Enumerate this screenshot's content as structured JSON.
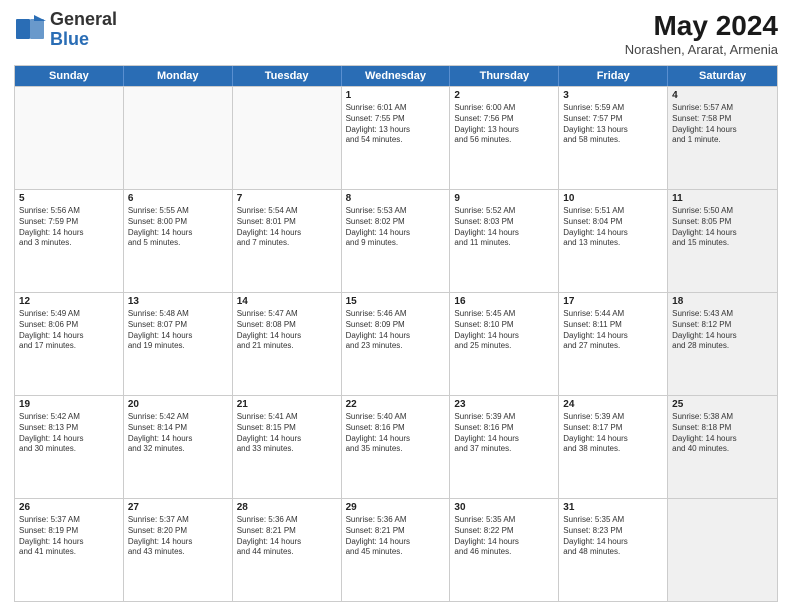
{
  "header": {
    "logo_general": "General",
    "logo_blue": "Blue",
    "month_title": "May 2024",
    "subtitle": "Norashen, Ararat, Armenia"
  },
  "days_of_week": [
    "Sunday",
    "Monday",
    "Tuesday",
    "Wednesday",
    "Thursday",
    "Friday",
    "Saturday"
  ],
  "rows": [
    [
      {
        "day": "",
        "lines": [],
        "shaded": false
      },
      {
        "day": "",
        "lines": [],
        "shaded": false
      },
      {
        "day": "",
        "lines": [],
        "shaded": false
      },
      {
        "day": "1",
        "lines": [
          "Sunrise: 6:01 AM",
          "Sunset: 7:55 PM",
          "Daylight: 13 hours",
          "and 54 minutes."
        ],
        "shaded": false
      },
      {
        "day": "2",
        "lines": [
          "Sunrise: 6:00 AM",
          "Sunset: 7:56 PM",
          "Daylight: 13 hours",
          "and 56 minutes."
        ],
        "shaded": false
      },
      {
        "day": "3",
        "lines": [
          "Sunrise: 5:59 AM",
          "Sunset: 7:57 PM",
          "Daylight: 13 hours",
          "and 58 minutes."
        ],
        "shaded": false
      },
      {
        "day": "4",
        "lines": [
          "Sunrise: 5:57 AM",
          "Sunset: 7:58 PM",
          "Daylight: 14 hours",
          "and 1 minute."
        ],
        "shaded": true
      }
    ],
    [
      {
        "day": "5",
        "lines": [
          "Sunrise: 5:56 AM",
          "Sunset: 7:59 PM",
          "Daylight: 14 hours",
          "and 3 minutes."
        ],
        "shaded": false
      },
      {
        "day": "6",
        "lines": [
          "Sunrise: 5:55 AM",
          "Sunset: 8:00 PM",
          "Daylight: 14 hours",
          "and 5 minutes."
        ],
        "shaded": false
      },
      {
        "day": "7",
        "lines": [
          "Sunrise: 5:54 AM",
          "Sunset: 8:01 PM",
          "Daylight: 14 hours",
          "and 7 minutes."
        ],
        "shaded": false
      },
      {
        "day": "8",
        "lines": [
          "Sunrise: 5:53 AM",
          "Sunset: 8:02 PM",
          "Daylight: 14 hours",
          "and 9 minutes."
        ],
        "shaded": false
      },
      {
        "day": "9",
        "lines": [
          "Sunrise: 5:52 AM",
          "Sunset: 8:03 PM",
          "Daylight: 14 hours",
          "and 11 minutes."
        ],
        "shaded": false
      },
      {
        "day": "10",
        "lines": [
          "Sunrise: 5:51 AM",
          "Sunset: 8:04 PM",
          "Daylight: 14 hours",
          "and 13 minutes."
        ],
        "shaded": false
      },
      {
        "day": "11",
        "lines": [
          "Sunrise: 5:50 AM",
          "Sunset: 8:05 PM",
          "Daylight: 14 hours",
          "and 15 minutes."
        ],
        "shaded": true
      }
    ],
    [
      {
        "day": "12",
        "lines": [
          "Sunrise: 5:49 AM",
          "Sunset: 8:06 PM",
          "Daylight: 14 hours",
          "and 17 minutes."
        ],
        "shaded": false
      },
      {
        "day": "13",
        "lines": [
          "Sunrise: 5:48 AM",
          "Sunset: 8:07 PM",
          "Daylight: 14 hours",
          "and 19 minutes."
        ],
        "shaded": false
      },
      {
        "day": "14",
        "lines": [
          "Sunrise: 5:47 AM",
          "Sunset: 8:08 PM",
          "Daylight: 14 hours",
          "and 21 minutes."
        ],
        "shaded": false
      },
      {
        "day": "15",
        "lines": [
          "Sunrise: 5:46 AM",
          "Sunset: 8:09 PM",
          "Daylight: 14 hours",
          "and 23 minutes."
        ],
        "shaded": false
      },
      {
        "day": "16",
        "lines": [
          "Sunrise: 5:45 AM",
          "Sunset: 8:10 PM",
          "Daylight: 14 hours",
          "and 25 minutes."
        ],
        "shaded": false
      },
      {
        "day": "17",
        "lines": [
          "Sunrise: 5:44 AM",
          "Sunset: 8:11 PM",
          "Daylight: 14 hours",
          "and 27 minutes."
        ],
        "shaded": false
      },
      {
        "day": "18",
        "lines": [
          "Sunrise: 5:43 AM",
          "Sunset: 8:12 PM",
          "Daylight: 14 hours",
          "and 28 minutes."
        ],
        "shaded": true
      }
    ],
    [
      {
        "day": "19",
        "lines": [
          "Sunrise: 5:42 AM",
          "Sunset: 8:13 PM",
          "Daylight: 14 hours",
          "and 30 minutes."
        ],
        "shaded": false
      },
      {
        "day": "20",
        "lines": [
          "Sunrise: 5:42 AM",
          "Sunset: 8:14 PM",
          "Daylight: 14 hours",
          "and 32 minutes."
        ],
        "shaded": false
      },
      {
        "day": "21",
        "lines": [
          "Sunrise: 5:41 AM",
          "Sunset: 8:15 PM",
          "Daylight: 14 hours",
          "and 33 minutes."
        ],
        "shaded": false
      },
      {
        "day": "22",
        "lines": [
          "Sunrise: 5:40 AM",
          "Sunset: 8:16 PM",
          "Daylight: 14 hours",
          "and 35 minutes."
        ],
        "shaded": false
      },
      {
        "day": "23",
        "lines": [
          "Sunrise: 5:39 AM",
          "Sunset: 8:16 PM",
          "Daylight: 14 hours",
          "and 37 minutes."
        ],
        "shaded": false
      },
      {
        "day": "24",
        "lines": [
          "Sunrise: 5:39 AM",
          "Sunset: 8:17 PM",
          "Daylight: 14 hours",
          "and 38 minutes."
        ],
        "shaded": false
      },
      {
        "day": "25",
        "lines": [
          "Sunrise: 5:38 AM",
          "Sunset: 8:18 PM",
          "Daylight: 14 hours",
          "and 40 minutes."
        ],
        "shaded": true
      }
    ],
    [
      {
        "day": "26",
        "lines": [
          "Sunrise: 5:37 AM",
          "Sunset: 8:19 PM",
          "Daylight: 14 hours",
          "and 41 minutes."
        ],
        "shaded": false
      },
      {
        "day": "27",
        "lines": [
          "Sunrise: 5:37 AM",
          "Sunset: 8:20 PM",
          "Daylight: 14 hours",
          "and 43 minutes."
        ],
        "shaded": false
      },
      {
        "day": "28",
        "lines": [
          "Sunrise: 5:36 AM",
          "Sunset: 8:21 PM",
          "Daylight: 14 hours",
          "and 44 minutes."
        ],
        "shaded": false
      },
      {
        "day": "29",
        "lines": [
          "Sunrise: 5:36 AM",
          "Sunset: 8:21 PM",
          "Daylight: 14 hours",
          "and 45 minutes."
        ],
        "shaded": false
      },
      {
        "day": "30",
        "lines": [
          "Sunrise: 5:35 AM",
          "Sunset: 8:22 PM",
          "Daylight: 14 hours",
          "and 46 minutes."
        ],
        "shaded": false
      },
      {
        "day": "31",
        "lines": [
          "Sunrise: 5:35 AM",
          "Sunset: 8:23 PM",
          "Daylight: 14 hours",
          "and 48 minutes."
        ],
        "shaded": false
      },
      {
        "day": "",
        "lines": [],
        "shaded": true
      }
    ]
  ]
}
